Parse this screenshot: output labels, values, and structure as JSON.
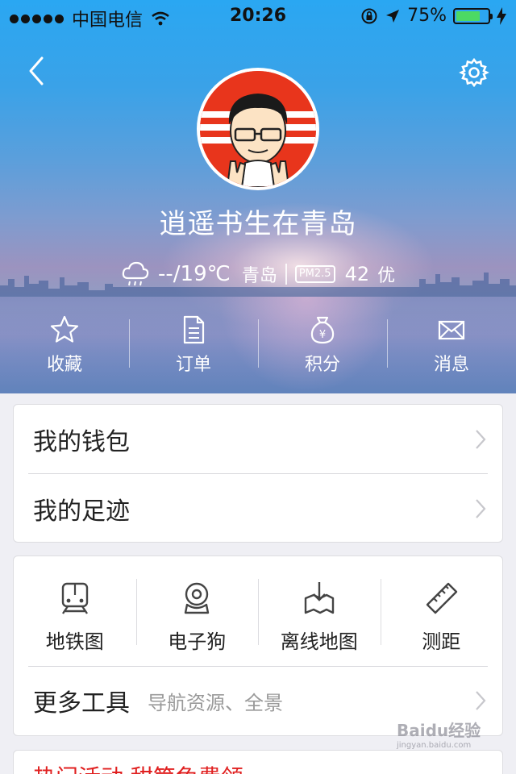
{
  "status_bar": {
    "carrier": "中国电信",
    "time": "20:26",
    "battery_percent": "75%",
    "signal_bars": 5,
    "battery_level": 0.75
  },
  "profile": {
    "username": "逍遥书生在青岛"
  },
  "weather": {
    "temperature": "--/19℃",
    "city": "青岛",
    "pm_label": "PM2.5",
    "aqi_value": "42",
    "aqi_level": "优"
  },
  "quick_actions": [
    {
      "label": "收藏",
      "icon": "star-icon"
    },
    {
      "label": "订单",
      "icon": "document-icon"
    },
    {
      "label": "积分",
      "icon": "money-bag-icon"
    },
    {
      "label": "消息",
      "icon": "envelope-icon"
    }
  ],
  "menu": {
    "wallet": "我的钱包",
    "footprints": "我的足迹"
  },
  "tools": [
    {
      "label": "地铁图",
      "icon": "subway-icon"
    },
    {
      "label": "电子狗",
      "icon": "camera-icon"
    },
    {
      "label": "离线地图",
      "icon": "offline-map-icon"
    },
    {
      "label": "测距",
      "icon": "ruler-icon"
    }
  ],
  "more_tools": {
    "label": "更多工具",
    "subtitle": "导航资源、全景"
  },
  "promo": {
    "text": "热门活动 甜筒免费领"
  },
  "watermark": {
    "text": "Baidu经验",
    "sub": "jingyan.baidu.com"
  }
}
